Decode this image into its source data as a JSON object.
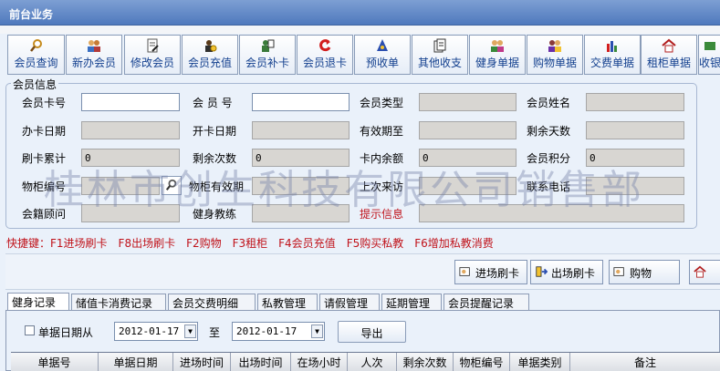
{
  "window": {
    "title": "前台业务"
  },
  "toolbar": {
    "items": [
      {
        "label": "会员查询",
        "icon": "magnifier-icon"
      },
      {
        "label": "新办会员",
        "icon": "users-icon"
      },
      {
        "label": "修改会员",
        "icon": "edit-doc-icon"
      },
      {
        "label": "会员充值",
        "icon": "person-coin-icon"
      },
      {
        "label": "会员补卡",
        "icon": "card-icon"
      },
      {
        "label": "会员退卡",
        "icon": "refund-icon"
      },
      {
        "label": "预收单",
        "icon": "receipt-icon"
      },
      {
        "label": "其他收支",
        "icon": "docs-icon"
      },
      {
        "label": "健身单据",
        "icon": "group-icon"
      },
      {
        "label": "购物单据",
        "icon": "cart-people-icon"
      },
      {
        "label": "交费单据",
        "icon": "bars-icon"
      },
      {
        "label": "租柜单据",
        "icon": "house-icon"
      },
      {
        "label": "收银",
        "icon": "cash-icon"
      }
    ]
  },
  "member_info": {
    "legend": "会员信息",
    "labels": {
      "card_no": "会员卡号",
      "member_no": "会 员 号",
      "member_type": "会员类型",
      "member_name": "会员姓名",
      "open_date": "办卡日期",
      "start_date": "开卡日期",
      "valid_until": "有效期至",
      "remaining_days": "剩余天数",
      "swipe_total": "刷卡累计",
      "remaining_times": "剩余次数",
      "card_balance": "卡内余额",
      "member_points": "会员积分",
      "locker_no": "物柜编号",
      "locker_expiry": "物柜有效期",
      "last_visit": "上次来访",
      "phone": "联系电话",
      "consultant": "会籍顾问",
      "coach": "健身教练",
      "hint": "提示信息"
    },
    "values": {
      "card_no": "",
      "member_no": "",
      "member_type": "",
      "member_name": "",
      "open_date": "",
      "start_date": "",
      "valid_until": "",
      "remaining_days": "",
      "swipe_total": "0",
      "remaining_times": "0",
      "card_balance": "0",
      "member_points": "0",
      "locker_no": "",
      "locker_expiry": "",
      "last_visit": "",
      "phone": "",
      "consultant": "",
      "coach": "",
      "hint": ""
    }
  },
  "watermark": "桂林市创生科技有限公司销售部",
  "shortcuts": "快捷键：F1进场刷卡　F8出场刷卡　F2购物　F3租柜　F4会员充值　F5购买私教　F6增加私教消费",
  "actions": {
    "enter": "进场刷卡",
    "exit": "出场刷卡",
    "shop": "购物",
    "more": ""
  },
  "tabs": [
    "健身记录",
    "储值卡消费记录",
    "会员交费明细",
    "私教管理",
    "请假管理",
    "延期管理",
    "会员提醒记录"
  ],
  "filter": {
    "checkbox_label": "单据日期从",
    "from": "2012-01-17",
    "to_label": "至",
    "to": "2012-01-17",
    "export": "导出"
  },
  "table": {
    "columns": [
      "单据号",
      "单据日期",
      "进场时间",
      "出场时间",
      "在场小时",
      "人次",
      "剩余次数",
      "物柜编号",
      "单据类别",
      "备注"
    ]
  },
  "colors": {
    "titlebar": "#5b82c2",
    "accent_text": "#123f8e",
    "warning": "#c0121a",
    "readonly_field": "#d8d6d2"
  }
}
